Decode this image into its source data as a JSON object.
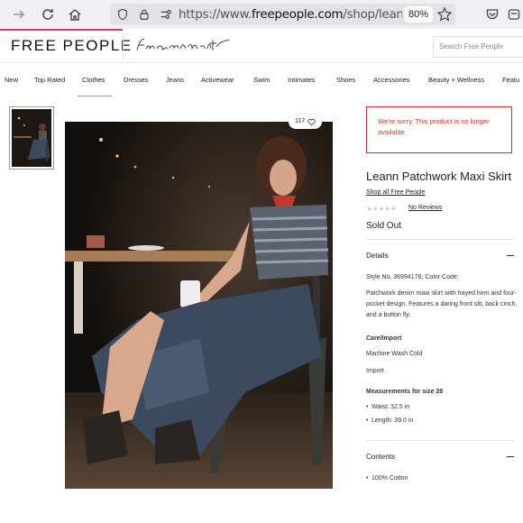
{
  "browser": {
    "url_prefix": "https://www.",
    "url_domain": "freepeople.com",
    "url_path": "/shop/leann-patchwo",
    "zoom": "80%"
  },
  "header": {
    "logo": "FREE PEOPLE",
    "search_placeholder": "Search Free People"
  },
  "categories": [
    "New",
    "Top Rated",
    "Clothes",
    "Dresses",
    "Jeans",
    "Activewear",
    "Swim",
    "Intimates",
    "Shoes",
    "Accessories",
    "Beauty + Wellness",
    "Featu"
  ],
  "photo": {
    "likes": "117"
  },
  "product": {
    "alert": "We're sorry. This product is no longer available.",
    "title": "Leann Patchwork Maxi Skirt",
    "shop_link": "Shop all Free People",
    "stars": "★★★★★",
    "reviews": "No Reviews",
    "status": "Sold Out"
  },
  "details": {
    "heading": "Details",
    "style": "Style No. 36994176; Color Code:",
    "description": "Patchwork denim maxi skirt with frayed hem and four-pocket design. Features a daring front slit, back cinch, and a button fly.",
    "care_heading": "Care/Import",
    "care": "Machine Wash Cold",
    "import": "Import",
    "measure_heading": "Measurements for size 28",
    "waist": "Waist: 32.5 in",
    "length": "Length: 39.0 in"
  },
  "contents": {
    "heading": "Contents",
    "item": "100% Cotton"
  }
}
